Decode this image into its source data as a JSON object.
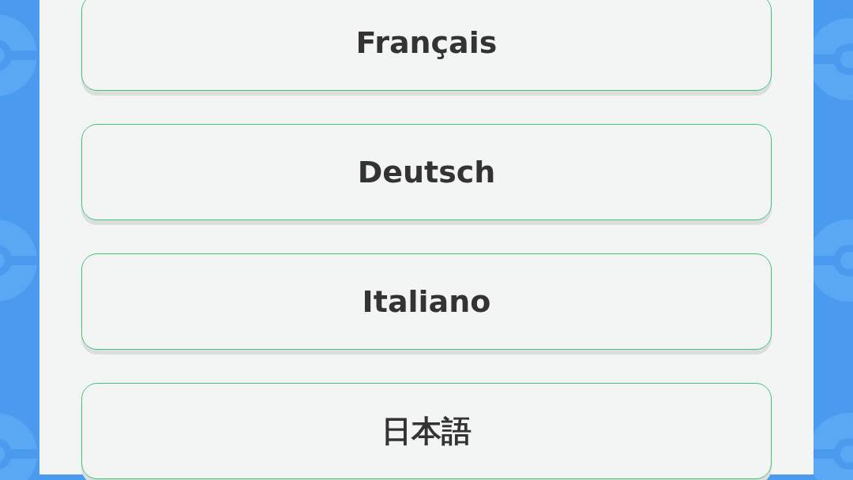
{
  "languages": [
    {
      "label": "Français"
    },
    {
      "label": "Deutsch"
    },
    {
      "label": "Italiano"
    },
    {
      "label": "日本語"
    }
  ]
}
